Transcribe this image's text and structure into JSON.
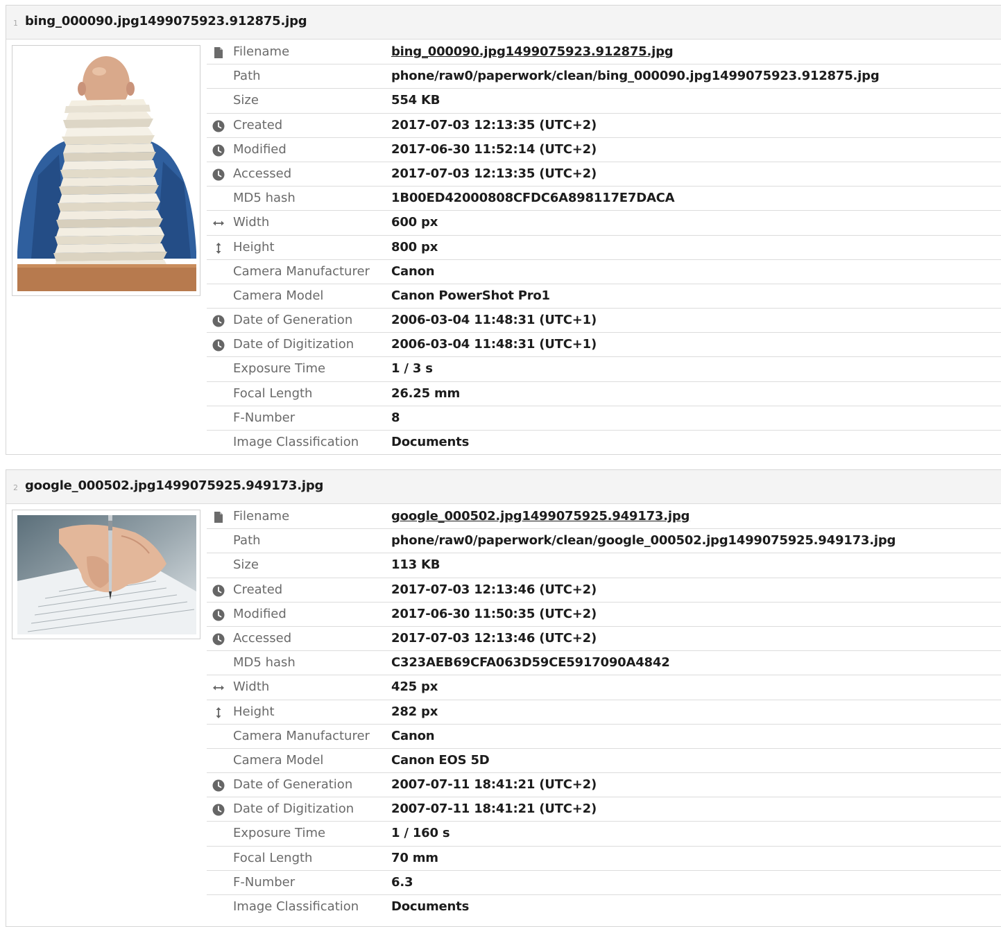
{
  "labels": {
    "filename": "Filename",
    "path": "Path",
    "size": "Size",
    "created": "Created",
    "modified": "Modified",
    "accessed": "Accessed",
    "md5": "MD5 hash",
    "width": "Width",
    "height": "Height",
    "camera_manufacturer": "Camera Manufacturer",
    "camera_model": "Camera Model",
    "date_generation": "Date of Generation",
    "date_digitization": "Date of Digitization",
    "exposure_time": "Exposure Time",
    "focal_length": "Focal Length",
    "f_number": "F-Number",
    "image_classification": "Image Classification"
  },
  "icons": {
    "file": "file-icon",
    "clock": "clock-icon",
    "width": "horizontal-arrows-icon",
    "height": "vertical-arrows-icon"
  },
  "colors": {
    "header_bg": "#f4f4f4",
    "icon": "#666666",
    "label": "#6a6a6a",
    "value": "#1c1c1c"
  },
  "items": [
    {
      "index": "1",
      "title": "bing_000090.jpg1499075923.912875.jpg",
      "filename": "bing_000090.jpg1499075923.912875.jpg",
      "path": "phone/raw0/paperwork/clean/bing_000090.jpg1499075923.912875.jpg",
      "size": "554 KB",
      "created": "2017-07-03 12:13:35 (UTC+2)",
      "modified": "2017-06-30 11:52:14 (UTC+2)",
      "accessed": "2017-07-03 12:13:35 (UTC+2)",
      "md5": "1B00ED42000808CFDC6A898117E7DACA",
      "width": "600 px",
      "height": "800 px",
      "camera_manufacturer": "Canon",
      "camera_model": "Canon PowerShot Pro1",
      "date_generation": "2006-03-04 11:48:31 (UTC+1)",
      "date_digitization": "2006-03-04 11:48:31 (UTC+1)",
      "exposure_time": "1 / 3 s",
      "focal_length": "26.25 mm",
      "f_number": "8",
      "image_classification": "Documents"
    },
    {
      "index": "2",
      "title": "google_000502.jpg1499075925.949173.jpg",
      "filename": "google_000502.jpg1499075925.949173.jpg",
      "path": "phone/raw0/paperwork/clean/google_000502.jpg1499075925.949173.jpg",
      "size": "113 KB",
      "created": "2017-07-03 12:13:46 (UTC+2)",
      "modified": "2017-06-30 11:50:35 (UTC+2)",
      "accessed": "2017-07-03 12:13:46 (UTC+2)",
      "md5": "C323AEB69CFA063D59CE5917090A4842",
      "width": "425 px",
      "height": "282 px",
      "camera_manufacturer": "Canon",
      "camera_model": "Canon EOS 5D",
      "date_generation": "2007-07-11 18:41:21 (UTC+2)",
      "date_digitization": "2007-07-11 18:41:21 (UTC+2)",
      "exposure_time": "1 / 160 s",
      "focal_length": "70 mm",
      "f_number": "6.3",
      "image_classification": "Documents"
    }
  ]
}
